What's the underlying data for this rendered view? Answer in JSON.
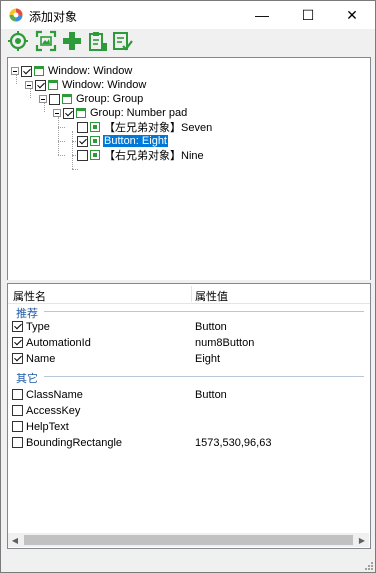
{
  "window": {
    "title": "添加对象",
    "minimize_glyph": "—",
    "maximize_glyph": "☐",
    "close_glyph": "✕"
  },
  "toolbar": {
    "buttons": [
      {
        "name": "locate-target-icon"
      },
      {
        "name": "capture-screenshot-icon"
      },
      {
        "name": "add-icon"
      },
      {
        "name": "clipboard-add-icon"
      },
      {
        "name": "verify-list-icon"
      }
    ],
    "accent": "#2e9b3a"
  },
  "tree": {
    "nodes": [
      {
        "label": "Window: Window",
        "checked": true
      },
      {
        "label": "Window: Window",
        "checked": true
      },
      {
        "label": "Group: Group",
        "checked": false
      },
      {
        "label": "Group: Number pad",
        "checked": true
      },
      {
        "label": "【左兄弟对象】Seven",
        "checked": false
      },
      {
        "label": "Button: Eight",
        "checked": true,
        "selected": true
      },
      {
        "label": "【右兄弟对象】Nine",
        "checked": false
      }
    ]
  },
  "properties": {
    "header_name": "属性名",
    "header_value": "属性值",
    "groups": [
      {
        "label": "推荐",
        "rows": [
          {
            "name": "Type",
            "value": "Button",
            "checked": true
          },
          {
            "name": "AutomationId",
            "value": "num8Button",
            "checked": true
          },
          {
            "name": "Name",
            "value": "Eight",
            "checked": true
          }
        ]
      },
      {
        "label": "其它",
        "rows": [
          {
            "name": "ClassName",
            "value": "Button",
            "checked": false
          },
          {
            "name": "AccessKey",
            "value": "",
            "checked": false
          },
          {
            "name": "HelpText",
            "value": "",
            "checked": false
          },
          {
            "name": "BoundingRectangle",
            "value": "1573,530,96,63",
            "checked": false
          }
        ]
      }
    ]
  },
  "scrollbar": {
    "left_glyph": "◀",
    "right_glyph": "▶"
  }
}
